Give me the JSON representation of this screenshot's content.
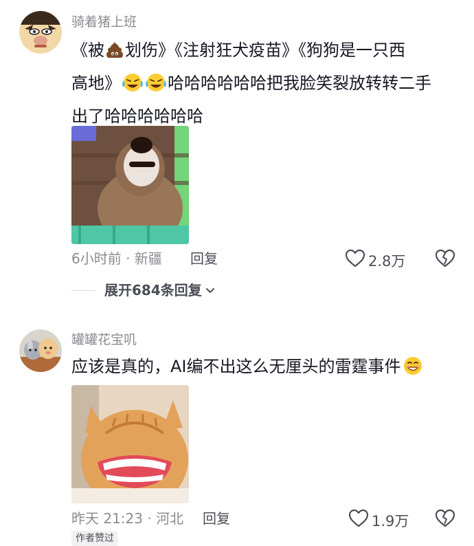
{
  "comments": [
    {
      "username": "骑着猪上班",
      "text_line1": "《被",
      "text_line1b": "划伤》《注射狂犬疫苗》《狗狗是一只西",
      "text_line2a": "高地》",
      "text_line2b": "哈哈哈哈哈哈把我脸笑裂放转转二手",
      "text_line3": "出了哈哈哈哈哈哈",
      "time_location": "6小时前 · 新疆",
      "reply_label": "回复",
      "likes": "2.8万",
      "expand_label": "展开684条回复",
      "emojis": [
        "poop-emoji",
        "laugh-cry-emoji",
        "laugh-cry-emoji"
      ]
    },
    {
      "username": "罐罐花宝叽",
      "text": "应该是真的，AI编不出这么无厘头的雷霆事件",
      "time_location": "昨天 21:23 · 河北",
      "reply_label": "回复",
      "likes": "1.9万",
      "author_badge": "作者赞过",
      "emojis": [
        "grin-emoji"
      ]
    }
  ],
  "icons": [
    "heart-icon",
    "broken-heart-icon",
    "chevron-down-icon"
  ],
  "colors": {
    "text": "#161823",
    "secondary": "#8a8b91",
    "action": "#4b4d56",
    "background": "#ffffff"
  }
}
